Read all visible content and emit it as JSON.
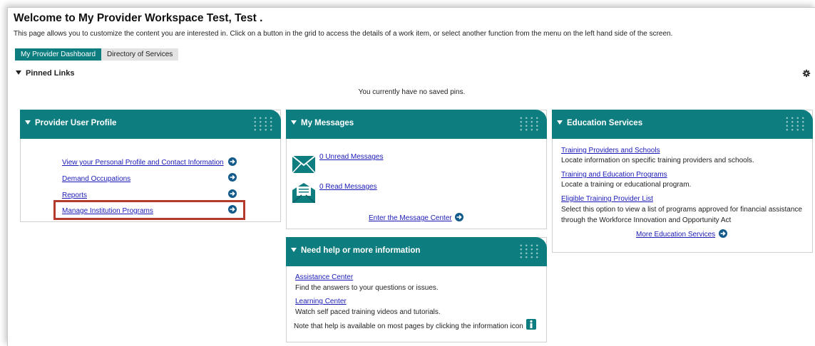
{
  "header": {
    "title": "Welcome to My Provider Workspace Test, Test .",
    "description": "This page allows you to customize the content you are interested in. Click on a button in the grid to access the details of a work item, or select another function from the menu on the left hand side of the screen."
  },
  "tabs": [
    {
      "label": "My Provider Dashboard",
      "active": true
    },
    {
      "label": "Directory of Services",
      "active": false
    }
  ],
  "pinned": {
    "header": "Pinned Links",
    "empty_text": "You currently have no saved pins."
  },
  "panels": {
    "profile": {
      "title": "Provider User Profile",
      "links": [
        "View your Personal Profile and Contact Information",
        "Demand Occupations",
        "Reports",
        "Manage Institution Programs"
      ]
    },
    "messages": {
      "title": "My Messages",
      "unread": "0 Unread Messages",
      "read": "0 Read Messages",
      "center": "Enter the Message Center"
    },
    "education": {
      "title": "Education Services",
      "items": [
        {
          "link": "Training Providers and Schools",
          "desc": "Locate information on specific training providers and schools."
        },
        {
          "link": "Training and Education Programs",
          "desc": "Locate a training or educational program."
        },
        {
          "link": "Eligible Training Provider List",
          "desc": "Select this option to view a list of programs approved for financial assistance",
          "desc2": "through the Workforce Innovation and Opportunity Act"
        }
      ],
      "more": "More Education Services"
    },
    "help": {
      "title": "Need help or more information",
      "items": [
        {
          "link": "Assistance Center",
          "desc": "Find the answers to your questions or issues."
        },
        {
          "link": "Learning Center",
          "desc": "Watch self paced training videos and tutorials."
        }
      ],
      "note": "Note that help is available on most pages by clicking the information icon"
    }
  },
  "colors": {
    "teal": "#0e7d80",
    "link": "#1a1ab8",
    "arrow": "#125a8a",
    "highlight": "#b33a2c"
  }
}
